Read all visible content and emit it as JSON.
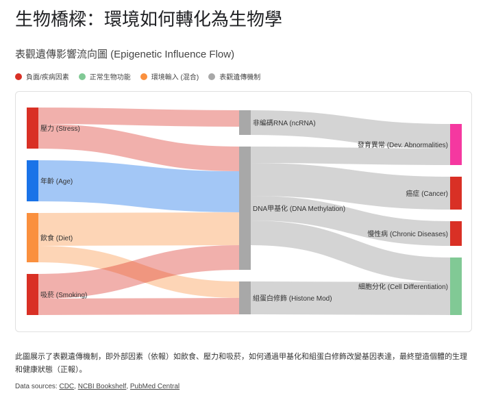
{
  "title": "生物橋樑：環境如何轉化為生物學",
  "subtitle": "表觀遺傳影響流向圖 (Epigenetic Influence Flow)",
  "legend": [
    {
      "label": "負面/疾病因素",
      "color": "#d93025"
    },
    {
      "label": "正常生物功能",
      "color": "#81c995"
    },
    {
      "label": "環境輸入 (混合)",
      "color": "#fa903e"
    },
    {
      "label": "表觀遺傳機制",
      "color": "#a8a8a8"
    }
  ],
  "chart_data": {
    "type": "sankey",
    "title": "表觀遺傳影響流向圖 (Epigenetic Influence Flow)",
    "nodes": [
      {
        "id": "stress",
        "label": "壓力 (Stress)",
        "column": 0,
        "color": "#d93025"
      },
      {
        "id": "age",
        "label": "年齡 (Age)",
        "column": 0,
        "color": "#1a73e8"
      },
      {
        "id": "diet",
        "label": "飲食 (Diet)",
        "column": 0,
        "color": "#fa903e"
      },
      {
        "id": "smoking",
        "label": "吸菸 (Smoking)",
        "column": 0,
        "color": "#d93025"
      },
      {
        "id": "ncrna",
        "label": "非編碼RNA (ncRNA)",
        "column": 1,
        "color": "#a8a8a8"
      },
      {
        "id": "dna",
        "label": "DNA甲基化 (DNA Methylation)",
        "column": 1,
        "color": "#a8a8a8"
      },
      {
        "id": "histone",
        "label": "組蛋白修飾 (Histone Mod)",
        "column": 1,
        "color": "#a8a8a8"
      },
      {
        "id": "dev",
        "label": "發育異常 (Dev. Abnormalities)",
        "column": 2,
        "color": "#f538a0"
      },
      {
        "id": "cancer",
        "label": "癌症 (Cancer)",
        "column": 2,
        "color": "#d93025"
      },
      {
        "id": "chronic",
        "label": "慢性病 (Chronic Diseases)",
        "column": 2,
        "color": "#d93025"
      },
      {
        "id": "cell",
        "label": "細胞分化 (Cell Differentiation)",
        "column": 2,
        "color": "#81c995"
      }
    ],
    "links": [
      {
        "source": "stress",
        "target": "ncrna",
        "value": 2
      },
      {
        "source": "stress",
        "target": "dna",
        "value": 3
      },
      {
        "source": "age",
        "target": "dna",
        "value": 5
      },
      {
        "source": "diet",
        "target": "dna",
        "value": 4
      },
      {
        "source": "diet",
        "target": "histone",
        "value": 2
      },
      {
        "source": "smoking",
        "target": "dna",
        "value": 3
      },
      {
        "source": "smoking",
        "target": "histone",
        "value": 2
      },
      {
        "source": "ncrna",
        "target": "dev",
        "value": 3
      },
      {
        "source": "dna",
        "target": "dev",
        "value": 2
      },
      {
        "source": "dna",
        "target": "cancer",
        "value": 4
      },
      {
        "source": "dna",
        "target": "chronic",
        "value": 3
      },
      {
        "source": "dna",
        "target": "cell",
        "value": 3
      },
      {
        "source": "histone",
        "target": "cell",
        "value": 4
      }
    ],
    "link_color_mechanism": "#cfcfcf"
  },
  "description": "此圖展示了表觀遺傳機制，即外部因素（依報）如飲食、壓力和吸菸，如何通過甲基化和組蛋白修飾改變基因表達，最終塑造個體的生理和健康狀態（正報）。",
  "sources": {
    "prefix": "Data sources: ",
    "links": [
      "CDC",
      "NCBI Bookshelf",
      "PubMed Central"
    ]
  }
}
